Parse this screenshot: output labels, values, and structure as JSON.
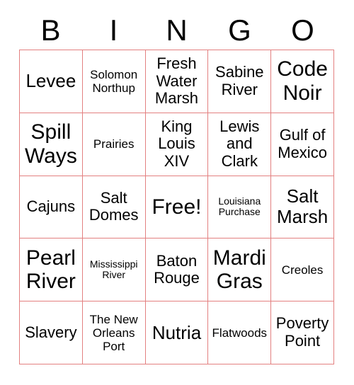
{
  "card": {
    "title": "BINGO",
    "header_letters": [
      "B",
      "I",
      "N",
      "G",
      "O"
    ],
    "colors": {
      "grid_border": "#e38080",
      "text": "#000000",
      "background": "#ffffff"
    },
    "free_space": "Free!",
    "rows": 5,
    "columns": 5
  },
  "cells": [
    {
      "text": "Levee",
      "size": "sz-lg",
      "row": 1,
      "col": 1,
      "free": false
    },
    {
      "text": "Solomon Northup",
      "size": "sz-sm",
      "row": 1,
      "col": 2,
      "free": false
    },
    {
      "text": "Fresh Water Marsh",
      "size": "sz-md",
      "row": 1,
      "col": 3,
      "free": false
    },
    {
      "text": "Sabine River",
      "size": "sz-md",
      "row": 1,
      "col": 4,
      "free": false
    },
    {
      "text": "Code Noir",
      "size": "sz-xl",
      "row": 1,
      "col": 5,
      "free": false
    },
    {
      "text": "Spill Ways",
      "size": "sz-xl",
      "row": 2,
      "col": 1,
      "free": false
    },
    {
      "text": "Prairies",
      "size": "sz-sm",
      "row": 2,
      "col": 2,
      "free": false
    },
    {
      "text": "King Louis XIV",
      "size": "sz-md",
      "row": 2,
      "col": 3,
      "free": false
    },
    {
      "text": "Lewis and Clark",
      "size": "sz-md",
      "row": 2,
      "col": 4,
      "free": false
    },
    {
      "text": "Gulf of Mexico",
      "size": "sz-md",
      "row": 2,
      "col": 5,
      "free": false
    },
    {
      "text": "Cajuns",
      "size": "sz-md",
      "row": 3,
      "col": 1,
      "free": false
    },
    {
      "text": "Salt Domes",
      "size": "sz-md",
      "row": 3,
      "col": 2,
      "free": false
    },
    {
      "text": "Free!",
      "size": "sz-xl",
      "row": 3,
      "col": 3,
      "free": true
    },
    {
      "text": "Louisiana Purchase",
      "size": "sz-xs",
      "row": 3,
      "col": 4,
      "free": false
    },
    {
      "text": "Salt Marsh",
      "size": "sz-lg",
      "row": 3,
      "col": 5,
      "free": false
    },
    {
      "text": "Pearl River",
      "size": "sz-xl",
      "row": 4,
      "col": 1,
      "free": false
    },
    {
      "text": "Mississippi River",
      "size": "sz-xs",
      "row": 4,
      "col": 2,
      "free": false
    },
    {
      "text": "Baton Rouge",
      "size": "sz-md",
      "row": 4,
      "col": 3,
      "free": false
    },
    {
      "text": "Mardi Gras",
      "size": "sz-xl",
      "row": 4,
      "col": 4,
      "free": false
    },
    {
      "text": "Creoles",
      "size": "sz-sm",
      "row": 4,
      "col": 5,
      "free": false
    },
    {
      "text": "Slavery",
      "size": "sz-md",
      "row": 5,
      "col": 1,
      "free": false
    },
    {
      "text": "The New Orleans Port",
      "size": "sz-sm",
      "row": 5,
      "col": 2,
      "free": false
    },
    {
      "text": "Nutria",
      "size": "sz-lg",
      "row": 5,
      "col": 3,
      "free": false
    },
    {
      "text": "Flatwoods",
      "size": "sz-sm",
      "row": 5,
      "col": 4,
      "free": false
    },
    {
      "text": "Poverty Point",
      "size": "sz-md",
      "row": 5,
      "col": 5,
      "free": false
    }
  ]
}
